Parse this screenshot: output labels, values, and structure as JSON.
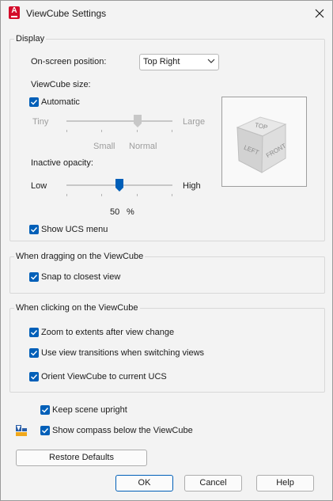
{
  "window": {
    "title": "ViewCube Settings",
    "app_icon_letter": "A"
  },
  "display": {
    "group_label": "Display",
    "onscreen_position_label": "On-screen position:",
    "onscreen_position_value": "Top Right",
    "size_label": "ViewCube size:",
    "automatic_label": "Automatic",
    "automatic_checked": true,
    "size_slider": {
      "left_label": "Tiny",
      "right_label": "Large",
      "under_labels": [
        "Small",
        "Normal"
      ],
      "value_fraction": 0.67,
      "enabled": false
    },
    "opacity_label": "Inactive opacity:",
    "opacity_slider": {
      "left_label": "Low",
      "right_label": "High",
      "value_fraction": 0.5
    },
    "opacity_value": "50",
    "opacity_unit": "%",
    "show_ucs_menu_label": "Show UCS menu",
    "show_ucs_menu_checked": true
  },
  "preview": {
    "faces": [
      "TOP",
      "LEFT",
      "FRONT"
    ]
  },
  "dragging": {
    "group_label": "When dragging on the ViewCube",
    "snap_label": "Snap to closest view",
    "snap_checked": true
  },
  "clicking": {
    "group_label": "When clicking on the ViewCube",
    "zoom_label": "Zoom to extents after view change",
    "zoom_checked": true,
    "transitions_label": "Use view transitions when switching views",
    "transitions_checked": true,
    "orient_label": "Orient ViewCube to current UCS",
    "orient_checked": true
  },
  "keep_upright_label": "Keep scene upright",
  "keep_upright_checked": true,
  "show_compass_label": "Show compass below the ViewCube",
  "show_compass_checked": true,
  "buttons": {
    "restore": "Restore Defaults",
    "ok": "OK",
    "cancel": "Cancel",
    "help": "Help"
  },
  "colors": {
    "accent": "#005fb8",
    "app_red": "#d40c2a"
  }
}
